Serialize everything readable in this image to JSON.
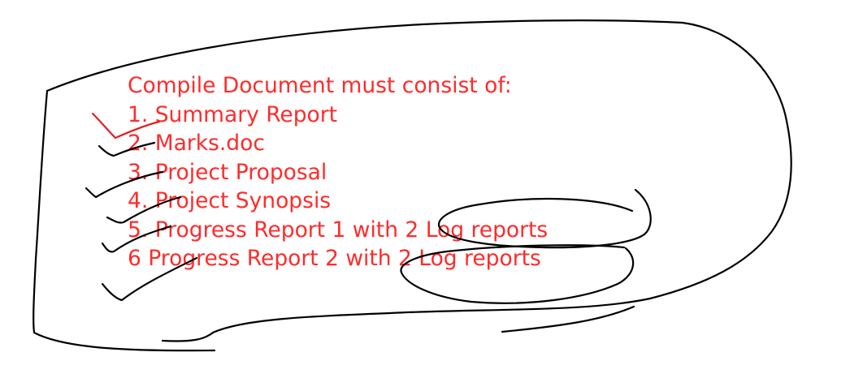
{
  "heading": "Compile Document must consist of:",
  "items": [
    "1. Summary Report",
    "2. Marks.doc",
    "3. Project Proposal",
    "4. Project Synopsis",
    "5. Progress Report 1 with 2 Log reports",
    "6 Progress Report 2 with 2 Log reports"
  ],
  "colors": {
    "text": "#ff2b2b",
    "ink": "#000000",
    "check_red": "#e02020",
    "background": "#ffffff"
  }
}
